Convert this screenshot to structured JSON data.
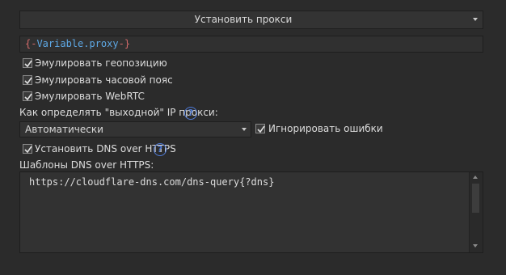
{
  "proxy_mode": {
    "selected": "Установить прокси"
  },
  "proxy_string": {
    "open": "{-",
    "variable": "Variable.proxy",
    "close": "-}"
  },
  "checkboxes": {
    "emulate_geo": {
      "label": "Эмулировать геопозицию",
      "checked": true
    },
    "emulate_timezone": {
      "label": "Эмулировать часовой пояс",
      "checked": true
    },
    "emulate_webrtc": {
      "label": "Эмулировать WebRTC",
      "checked": true
    },
    "ignore_errors": {
      "label": "Игнорировать ошибки",
      "checked": true
    },
    "set_dns_https": {
      "label": "Установить DNS over HTTPS",
      "checked": true
    }
  },
  "outbound_ip": {
    "label": "Как определять \"выходной\" IP прокси:",
    "selected": "Автоматически"
  },
  "dns_templates": {
    "label": "Шаблоны DNS over HTTPS:",
    "value": "https://cloudflare-dns.com/dns-query{?dns}"
  },
  "icons": {
    "help": "?"
  },
  "colors": {
    "background": "#2b2b2b",
    "accent": "#4f7bd9",
    "variable": "#5ea9e6",
    "brace": "#d46b6b"
  }
}
